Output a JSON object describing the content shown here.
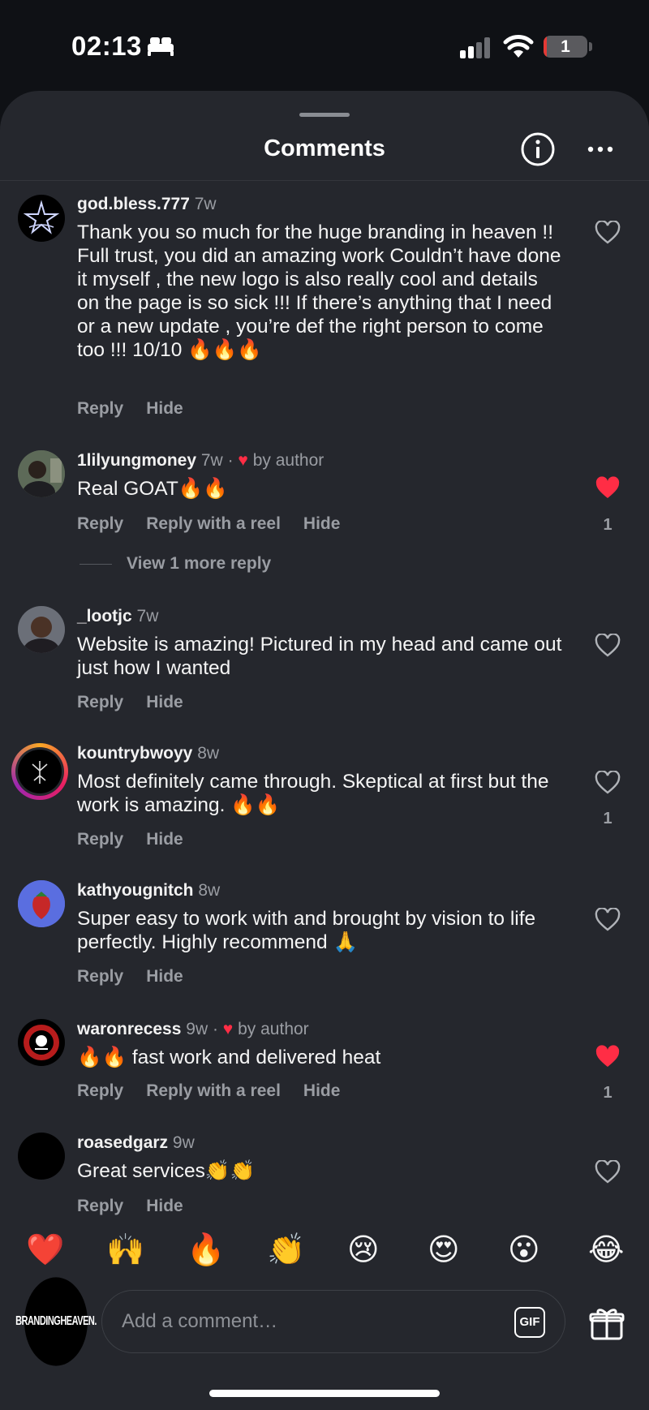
{
  "status_bar": {
    "time": "02:13",
    "battery": "1",
    "battery_level": 0.08
  },
  "header": {
    "title": "Comments"
  },
  "comments": [
    {
      "username": "god.bless.777",
      "time": "7w",
      "liked_by_author": false,
      "text": "Thank you so much for the huge branding in heaven !! Full trust, you did an amazing work Couldn’t have done it myself , the new logo is also really cool and details on the page is so sick !!! If there’s anything that I need or a new update , you’re def the right person to come too !!! 10/10 🔥🔥🔥",
      "actions": [
        "Reply",
        "Hide"
      ],
      "liked": false,
      "likes": ""
    },
    {
      "username": "1lilyungmoney",
      "time": "7w",
      "liked_by_author": true,
      "author_label": "by author",
      "text": "Real GOAT🔥🔥",
      "actions": [
        "Reply",
        "Reply with a reel",
        "Hide"
      ],
      "liked": true,
      "likes": "1",
      "more_replies": "View 1 more reply"
    },
    {
      "username": "_lootjc",
      "time": "7w",
      "liked_by_author": false,
      "text": "Website is amazing! Pictured in my head and came out just how I wanted",
      "actions": [
        "Reply",
        "Hide"
      ],
      "liked": false,
      "likes": ""
    },
    {
      "username": "kountrybwoyy",
      "time": "8w",
      "liked_by_author": false,
      "text": "Most definitely came through. Skeptical at first but the work is amazing. 🔥🔥",
      "actions": [
        "Reply",
        "Hide"
      ],
      "liked": false,
      "likes": "1"
    },
    {
      "username": "kathyougnitch",
      "time": "8w",
      "liked_by_author": false,
      "text": "Super easy to work with and brought by vision to life perfectly. Highly recommend 🙏",
      "actions": [
        "Reply",
        "Hide"
      ],
      "liked": false,
      "likes": ""
    },
    {
      "username": "waronrecess",
      "time": "9w",
      "liked_by_author": true,
      "author_label": "by author",
      "text": "🔥🔥 fast work and delivered heat",
      "actions": [
        "Reply",
        "Reply with a reel",
        "Hide"
      ],
      "liked": true,
      "likes": "1"
    },
    {
      "username": "roasedgarz",
      "time": "9w",
      "liked_by_author": false,
      "text": "Great services👏👏",
      "actions": [
        "Reply",
        "Hide"
      ],
      "liked": false,
      "likes": ""
    }
  ],
  "emoji_bar": [
    "❤️",
    "🙌",
    "🔥",
    "👏",
    "😢",
    "😍",
    "😮",
    "😂"
  ],
  "composer": {
    "placeholder": "Add a comment…",
    "gif_label": "GIF",
    "avatar_text": "BRANDINGHEAVEN."
  },
  "colors": {
    "like_red": "#ff2d45",
    "sheet_bg": "#25272d",
    "muted_text": "#9a9da3"
  }
}
